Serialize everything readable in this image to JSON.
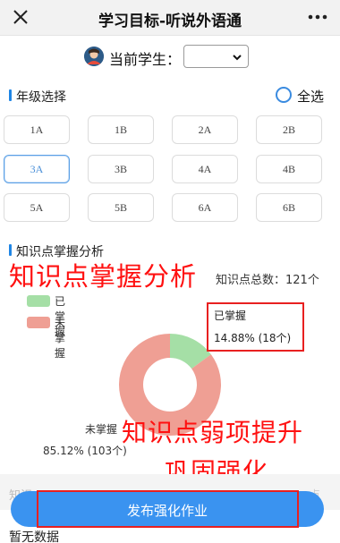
{
  "header": {
    "title": "学习目标-听说外语通",
    "close_icon": "close-icon",
    "more_icon": "more-icon"
  },
  "student": {
    "label": "当前学生：",
    "selected_value": ""
  },
  "grade_section": {
    "title": "年级选择",
    "select_all_label": "全选",
    "grades": [
      "1A",
      "1B",
      "2A",
      "2B",
      "3A",
      "3B",
      "4A",
      "4B",
      "5A",
      "5B",
      "6A",
      "6B"
    ],
    "selected": "3A"
  },
  "analysis_section": {
    "title": "知识点掌握分析",
    "total_label": "知识点总数：121个",
    "legend": [
      {
        "label": "已掌握",
        "color": "#a5dfa6"
      },
      {
        "label": "未掌握",
        "color": "#ef9f94"
      }
    ],
    "mastered_label": "已掌握",
    "mastered_value": "14.88% (18个)",
    "unmastered_label": "未掌握",
    "unmastered_value": "85.12% (103个)"
  },
  "chart_data": {
    "type": "pie",
    "categories": [
      "已掌握",
      "未掌握"
    ],
    "values": [
      18,
      103
    ],
    "percentages": [
      14.88,
      85.12
    ],
    "colors": [
      "#a5dfa6",
      "#ef9f94"
    ],
    "donut": true
  },
  "annotations": {
    "overlay_title": "知识点掌握分析",
    "overlay_line1": "知识点弱项提升",
    "overlay_line2": "巩固强化"
  },
  "footer": {
    "faded_left": "知识",
    "faded_right": "点",
    "publish_label": "发布强化作业",
    "no_data": "暂无数据"
  }
}
